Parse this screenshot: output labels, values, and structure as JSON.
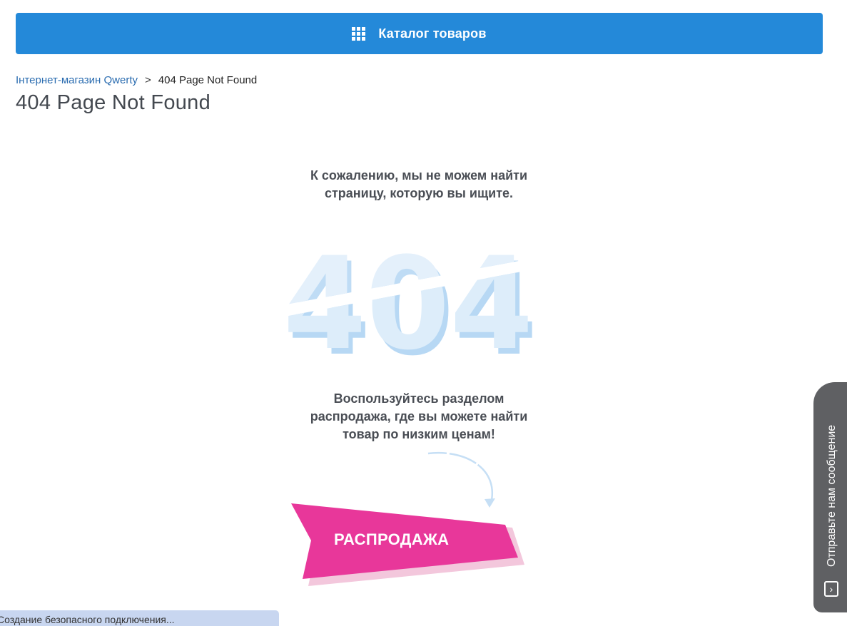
{
  "catalog": {
    "label": "Каталог товаров",
    "icon": "grid-icon",
    "color": "#2489d9"
  },
  "breadcrumb": {
    "home": "Інтернет-магазин Qwerty",
    "separator": ">",
    "current": "404 Page Not Found"
  },
  "page": {
    "title": "404 Page Not Found",
    "sorry_line1": "К сожалению, мы не можем найти",
    "sorry_line2": "страницу, которую вы ищите.",
    "graphic_text": "404",
    "suggest_line1": "Воспользуйтесь разделом",
    "suggest_line2": "распродажа, где вы можете найти",
    "suggest_line3": "товар по низким ценам!"
  },
  "sale": {
    "label": "РАСПРОДАЖА",
    "color": "#e8379a"
  },
  "feedback": {
    "label": "Отправьте нам сообщение",
    "icon": "chevron-right-icon"
  },
  "status": {
    "text": "Создание безопасного подключения..."
  }
}
